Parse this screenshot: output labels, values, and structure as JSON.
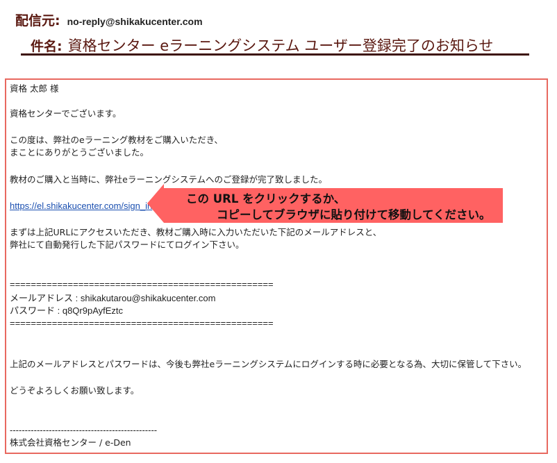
{
  "header": {
    "from_label": "配信元:",
    "from_value": "no-reply@shikakucenter.com",
    "subject_label": "件名:",
    "subject_value": "資格センター eラーニングシステム ユーザー登録完了のお知らせ"
  },
  "body": {
    "greeting": "資格 太郎 様",
    "intro": "資格センターでございます。",
    "thanks_line1": "この度は、弊社のeラーニング教材をご購入いただき、",
    "thanks_line2": "まことにありがとうございました。",
    "registration": "教材のご購入と当時に、弊社eラーニングシステムへのご登録が完了致しました。",
    "signin_url": "https://el.shikakucenter.com/sign_in",
    "access_line1": "まずは上記URLにアクセスいただき、教材ご購入時に入力いただいた下記のメールアドレスと、",
    "access_line2": "弊社にて自動発行した下記パスワードにてログイン下さい。",
    "separator": "==================================================",
    "email_line": "メールアドレス : shikakutarou@shikakucenter.com",
    "password_line": "パスワード : q8Qr9pAyfEztc",
    "reminder": "上記のメールアドレスとパスワードは、今後も弊社eラーニングシステムにログインする時に必要となる為、大切に保管して下さい。",
    "closing": "どうぞよろしくお願い致します。",
    "signature_rule": "-------------------------------------------------",
    "signature": "株式会社資格センター / e-Den"
  },
  "callout": {
    "line1": "この URL をクリックするか、",
    "line2": "コピーしてブラウザに貼り付けて移動してください。",
    "color": "#ff6262"
  }
}
